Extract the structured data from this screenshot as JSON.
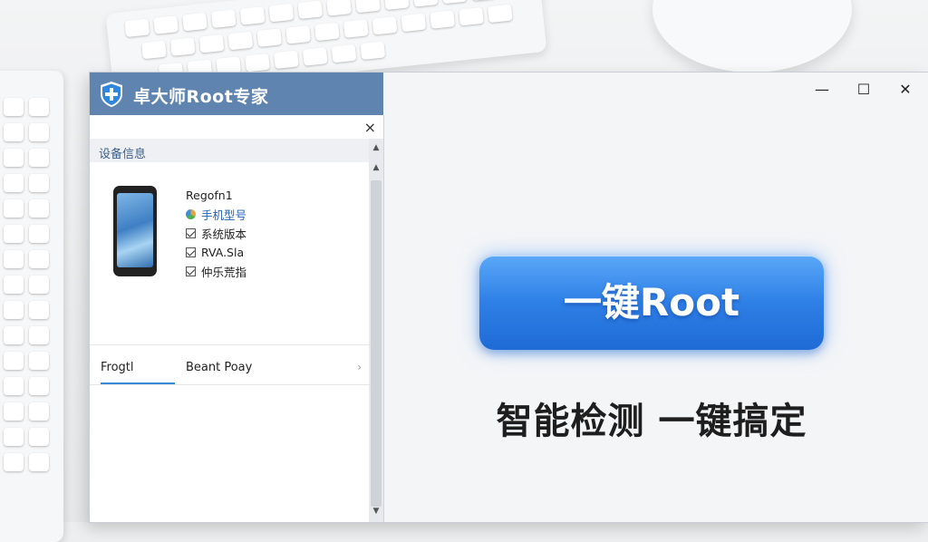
{
  "window": {
    "title": "卓大师Root专家",
    "minimize_glyph": "—",
    "maximize_glyph": "☐",
    "close_glyph": "✕"
  },
  "panel": {
    "close_glyph": "×",
    "section_title": "设备信息",
    "device_name": "Regofn1",
    "rows": [
      {
        "label": "手机型号",
        "icon": "status-dot-icon"
      },
      {
        "label": "系统版本",
        "icon": "checkbox-icon"
      },
      {
        "label": "RVA.Sla",
        "icon": "checkbox-icon"
      },
      {
        "label": "仲乐荒指",
        "icon": "checkbox-icon"
      }
    ],
    "tabs": [
      {
        "label": "Frogtl"
      },
      {
        "label": "Beant Poay"
      }
    ],
    "tab_arrow": "›"
  },
  "main": {
    "root_button_label": "一键Root",
    "slogan": "智能检测 一键搞定"
  },
  "colors": {
    "title_bar": "#5f84b0",
    "root_button": "#2e7fe6",
    "active_tab_underline": "#3a88d6"
  }
}
